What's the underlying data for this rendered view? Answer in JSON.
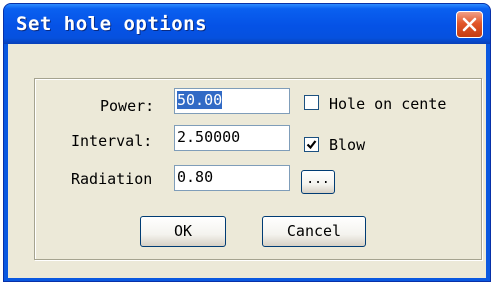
{
  "window": {
    "title": "Set hole options",
    "close_icon": "close-icon"
  },
  "form": {
    "power_label": "Power:",
    "power_value": "50.00",
    "interval_label": "Interval:",
    "interval_value": "2.50000",
    "radiation_label": "Radiation",
    "radiation_value": "0.80",
    "browse_label": "...",
    "hole_on_center_label": "Hole on cente",
    "hole_on_center_checked": false,
    "blow_label": "Blow",
    "blow_checked": true
  },
  "buttons": {
    "ok_label": "OK",
    "cancel_label": "Cancel"
  },
  "colors": {
    "titlebar": "#0552e6",
    "dialog_face": "#ece9d8",
    "selection": "#316ac5",
    "close_button": "#e2572a"
  }
}
